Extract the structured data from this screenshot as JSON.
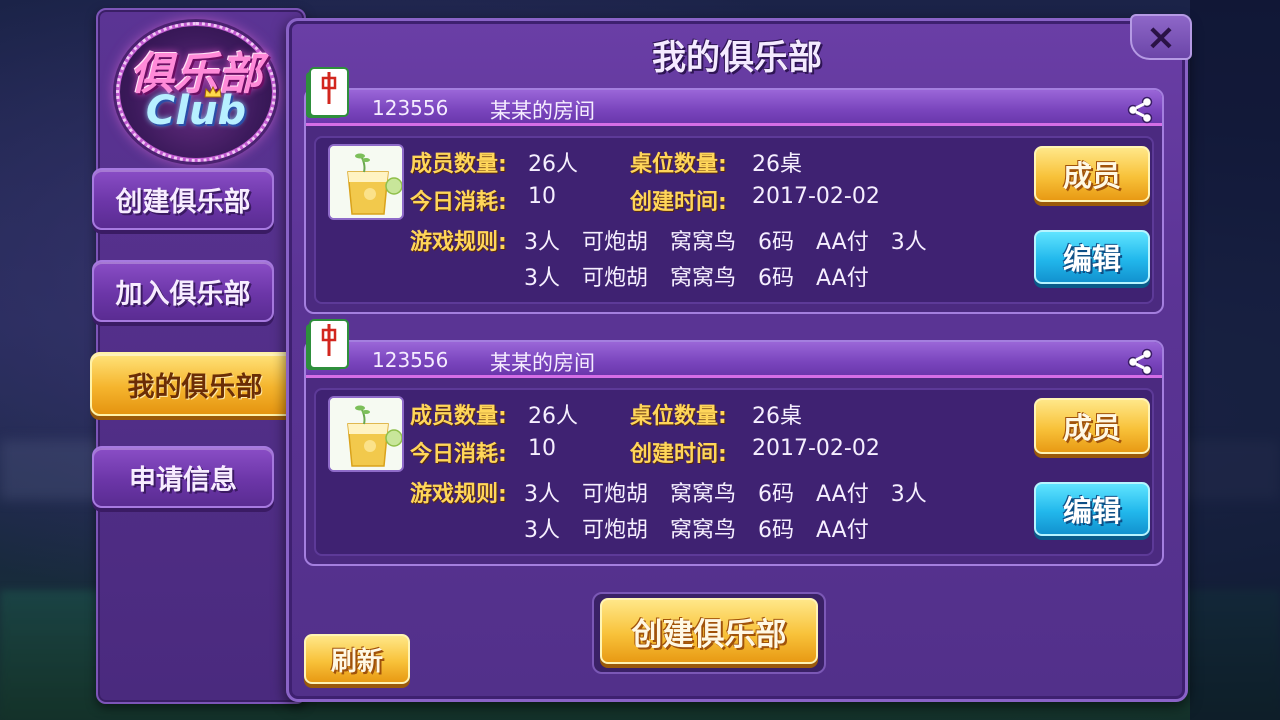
{
  "sidebar": {
    "logo_cn": "俱乐部",
    "logo_en": "Club",
    "items": [
      {
        "label": "创建俱乐部",
        "active": false
      },
      {
        "label": "加入俱乐部",
        "active": false
      },
      {
        "label": "我的俱乐部",
        "active": true
      },
      {
        "label": "申请信息",
        "active": false
      }
    ]
  },
  "main": {
    "title": "我的俱乐部",
    "close_icon": "×",
    "clubs": [
      {
        "id": "123556",
        "name": "某某的房间",
        "members_label": "成员数量:",
        "members_value": "26人",
        "tables_label": "桌位数量:",
        "tables_value": "26桌",
        "consume_label": "今日消耗:",
        "consume_value": "10",
        "created_label": "创建时间:",
        "created_value": "2017-02-02",
        "rules_label": "游戏规则:",
        "rules_line1": "3人　可炮胡　窝窝鸟　6码　AA付　3人",
        "rules_line2": "3人　可炮胡　窝窝鸟　6码　AA付",
        "members_button": "成员",
        "edit_button": "编辑"
      },
      {
        "id": "123556",
        "name": "某某的房间",
        "members_label": "成员数量:",
        "members_value": "26人",
        "tables_label": "桌位数量:",
        "tables_value": "26桌",
        "consume_label": "今日消耗:",
        "consume_value": "10",
        "created_label": "创建时间:",
        "created_value": "2017-02-02",
        "rules_label": "游戏规则:",
        "rules_line1": "3人　可炮胡　窝窝鸟　6码　AA付　3人",
        "rules_line2": "3人　可炮胡　窝窝鸟　6码　AA付",
        "members_button": "成员",
        "edit_button": "编辑"
      }
    ],
    "create_button": "创建俱乐部",
    "refresh_button": "刷新"
  },
  "icons": {
    "tile": "mahjong-tile-icon",
    "share": "share-icon",
    "close": "close-icon",
    "thumb": "drink-thumbnail"
  },
  "colors": {
    "panel": "#5b3495",
    "gold_button": "#f8c23a",
    "blue_button": "#22b8ec",
    "label_gold": "#ffd65a"
  }
}
